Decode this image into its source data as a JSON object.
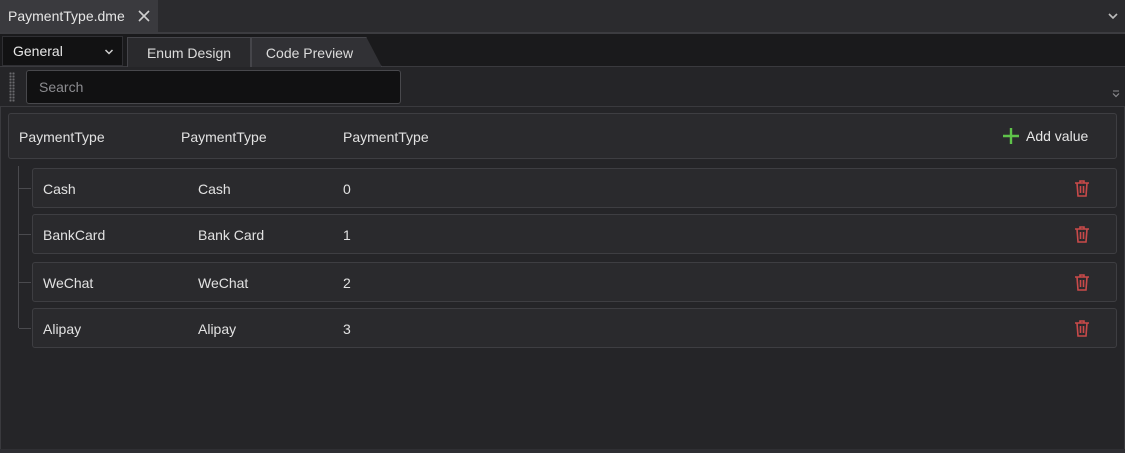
{
  "document_tab": {
    "title": "PaymentType.dme"
  },
  "toolbar": {
    "category_select": "General",
    "tabs": [
      {
        "label": "Enum Design"
      },
      {
        "label": "Code Preview"
      }
    ]
  },
  "search": {
    "placeholder": "Search",
    "value": ""
  },
  "table": {
    "headers": [
      "PaymentType",
      "PaymentType",
      "PaymentType"
    ],
    "add_label": "Add value",
    "rows": [
      {
        "name": "Cash",
        "display": "Cash",
        "value": "0"
      },
      {
        "name": "BankCard",
        "display": "Bank Card",
        "value": "1"
      },
      {
        "name": "WeChat",
        "display": "WeChat",
        "value": "2"
      },
      {
        "name": "Alipay",
        "display": "Alipay",
        "value": "3"
      }
    ]
  },
  "colors": {
    "add_icon": "#5fc34a",
    "delete_icon": "#c94a4a",
    "background": "#252528"
  },
  "icons": {
    "close": "close-icon",
    "chevron": "chevron-down-icon",
    "add": "plus-icon",
    "delete": "trash-icon"
  }
}
